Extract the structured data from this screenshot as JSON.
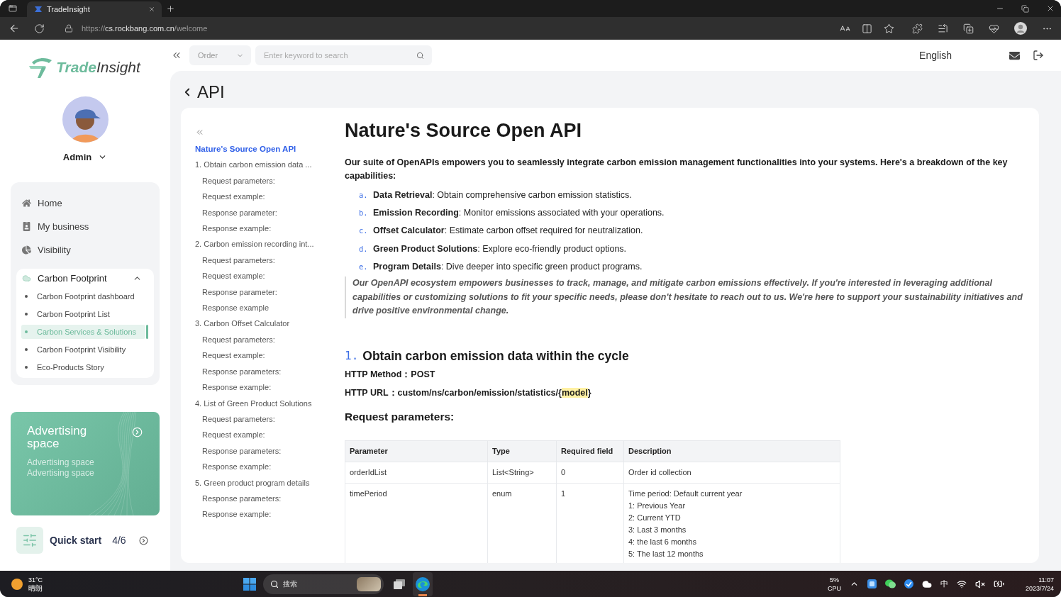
{
  "browser": {
    "tab_title": "TradeInsight",
    "url_scheme": "https://",
    "url_host": "cs.rockbang.com.cn",
    "url_path": "/welcome"
  },
  "sidebar": {
    "logo": {
      "part_1": "Trade",
      "part_2": "Insight"
    },
    "user": "Admin",
    "nav": [
      {
        "label": "Home",
        "selected": false
      },
      {
        "label": "My business",
        "selected": false
      },
      {
        "label": "Visibility",
        "selected": false
      }
    ],
    "group": {
      "label": "Carbon Footprint",
      "expanded": true,
      "items": [
        {
          "label": "Carbon Footprint dashboard",
          "selected": false
        },
        {
          "label": "Carbon Footprint List",
          "selected": false
        },
        {
          "label": "Carbon Services & Solutions",
          "selected": true
        },
        {
          "label": "Carbon Footprint Visibility",
          "selected": false
        },
        {
          "label": "Eco-Products Story",
          "selected": false
        }
      ]
    },
    "ad": {
      "title": "Advertising space",
      "subtitle": "Advertising space Advertising space"
    },
    "quick_start": {
      "label": "Quick start",
      "count": "4/6"
    }
  },
  "topbar": {
    "category": "Order",
    "search_placeholder": "Enter keyword to search",
    "language": "English"
  },
  "page": {
    "title": "API"
  },
  "toc": {
    "items": [
      {
        "label": "Nature's Source Open API",
        "selected": true
      },
      {
        "label": "1. Obtain carbon emission data ...",
        "selected": false,
        "children": [
          {
            "label": "Request parameters:",
            "selected": false
          },
          {
            "label": "Request example:",
            "selected": false
          },
          {
            "label": "Response parameter:",
            "selected": false
          },
          {
            "label": "Response example:",
            "selected": false
          }
        ]
      },
      {
        "label": "2. Carbon emission recording int...",
        "selected": false,
        "children": [
          {
            "label": "Request parameters:",
            "selected": false
          },
          {
            "label": "Request example:",
            "selected": false
          },
          {
            "label": "Response parameter:",
            "selected": false
          },
          {
            "label": "Response example",
            "selected": false
          }
        ]
      },
      {
        "label": "3. Carbon Offset Calculator",
        "selected": false,
        "children": [
          {
            "label": "Request parameters:",
            "selected": false
          },
          {
            "label": "Request example:",
            "selected": false
          },
          {
            "label": "Response parameters:",
            "selected": false
          },
          {
            "label": "Response example:",
            "selected": false
          }
        ]
      },
      {
        "label": "4. List of Green Product Solutions",
        "selected": false,
        "children": [
          {
            "label": "Request parameters:",
            "selected": false
          },
          {
            "label": "Request example:",
            "selected": false
          },
          {
            "label": "Response parameters:",
            "selected": false
          },
          {
            "label": "Response example:",
            "selected": false
          }
        ]
      },
      {
        "label": "5. Green product program details",
        "selected": false,
        "children": [
          {
            "label": "Response parameters:",
            "selected": false
          },
          {
            "label": "Response example:",
            "selected": false
          }
        ]
      }
    ]
  },
  "article": {
    "title": "Nature's Source Open API",
    "intro": "Our suite of OpenAPIs empowers you to seamlessly integrate carbon emission management functionalities into your systems. Here's a breakdown of the key capabilities:",
    "capabilities": [
      {
        "marker": "a.",
        "text": "**Data Retrieval**: Obtain comprehensive carbon emission statistics."
      },
      {
        "marker": "b.",
        "text": "**Emission Recording**: Monitor emissions associated with your operations."
      },
      {
        "marker": "c.",
        "text": "**Offset Calculator**: Estimate carbon offset required for neutralization."
      },
      {
        "marker": "d.",
        "text": "**Green Product Solutions**: Explore eco-friendly product options."
      },
      {
        "marker": "e.",
        "text": "**Program Details**: Dive deeper into specific green product programs."
      }
    ],
    "note": "Our OpenAPI ecosystem empowers businesses to track, manage, and mitigate carbon emissions effectively. If you're interested in leveraging additional capabilities or customizing solutions to fit your specific needs, please don't hesitate to reach out to us. We're here to support your sustainability initiatives and drive positive environmental change.",
    "sections": [
      {
        "number": "1.",
        "title": "Obtain carbon emission data within the cycle",
        "method": "HTTP Method：POST",
        "url_parts": [
          {
            "text": "HTTP URL：custom/ns/carbon/emission/statistics/{",
            "highlighted": false
          },
          {
            "text": "model",
            "highlighted": true
          },
          {
            "text": "}",
            "highlighted": false
          }
        ],
        "subheading": "Request parameters:",
        "table": {
          "columns": [
            "Parameter",
            "Type",
            "Required field",
            "Description"
          ],
          "rows": [
            [
              "orderIdList",
              "List<String>",
              "0",
              "Order id collection"
            ],
            [
              "timePeriod",
              "enum",
              "1",
              "Time period: Default current year\n1: Previous Year\n2: Current YTD\n3: Last 3 months\n4: the last 6 months\n5: The last 12 months"
            ]
          ]
        }
      }
    ]
  },
  "taskbar": {
    "weather": {
      "temperature": "31°C",
      "condition": "晴朗"
    },
    "search_placeholder": "搜索",
    "apps": [
      {
        "selected": false
      },
      {
        "selected": true
      }
    ],
    "cpu": {
      "value": "5%",
      "label": "CPU"
    },
    "input_method": "中",
    "time": "11:07",
    "date": "2023/7/24"
  }
}
